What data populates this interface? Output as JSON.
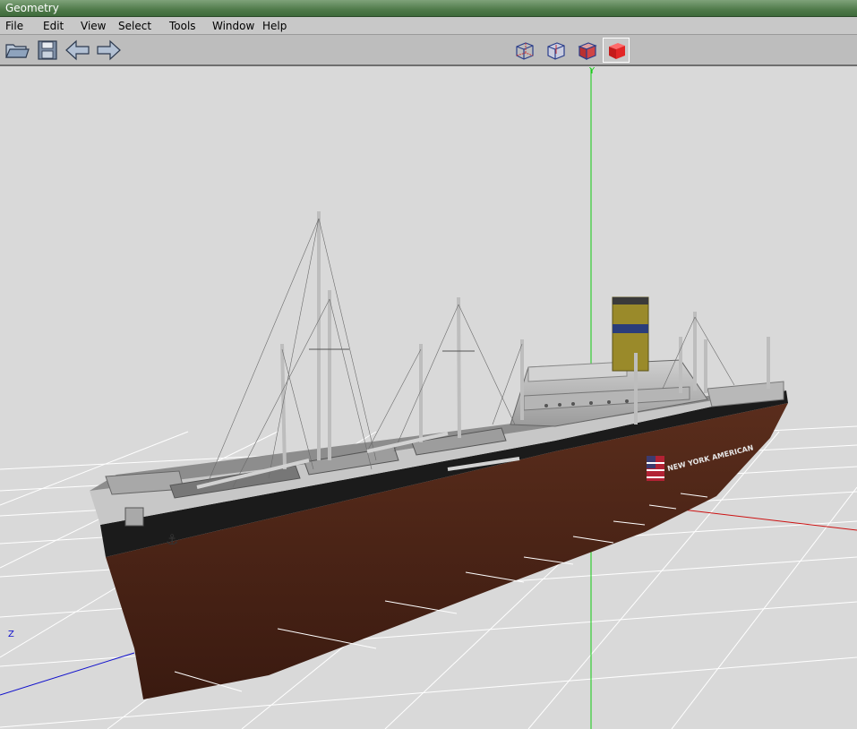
{
  "window": {
    "title": "Geometry"
  },
  "menu": [
    {
      "id": "file",
      "label": "File"
    },
    {
      "id": "edit",
      "label": "Edit"
    },
    {
      "id": "view",
      "label": "View"
    },
    {
      "id": "select",
      "label": "Select"
    },
    {
      "id": "tools",
      "label": "Tools"
    },
    {
      "id": "window",
      "label": "Window"
    },
    {
      "id": "help",
      "label": "Help"
    }
  ],
  "toolbar": {
    "left_icons": [
      "open-folder-icon",
      "save-disk-icon",
      "undo-arrow-icon",
      "redo-arrow-icon"
    ],
    "view_modes": [
      "wireframe-cube-icon",
      "wireframe-hidden-cube-icon",
      "shaded-wire-cube-icon",
      "solid-cube-icon"
    ],
    "active_view_mode": "solid-cube-icon"
  },
  "viewport": {
    "axes": {
      "y": "Y",
      "z": "Z"
    },
    "colors": {
      "y_axis": "#11cc11",
      "x_axis": "#cc1111",
      "z_axis": "#1111cc",
      "grid": "#ffffff",
      "background": "#d9d9d9"
    },
    "model": {
      "hull_text": "NEW YORK AMERICAN"
    }
  }
}
